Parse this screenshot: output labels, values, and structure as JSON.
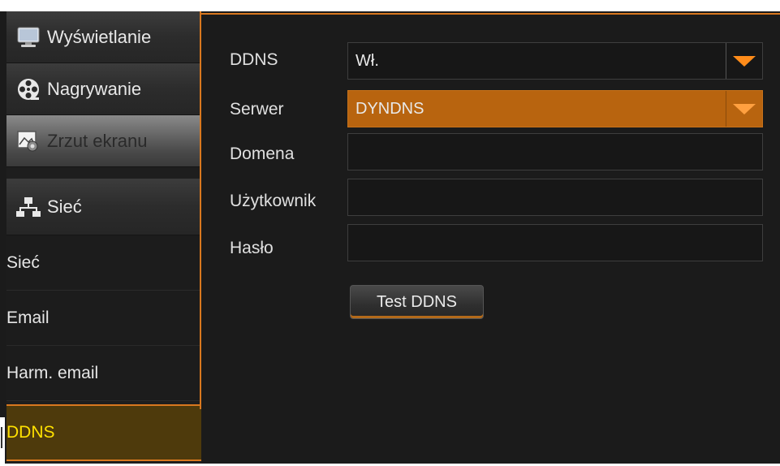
{
  "sidebar": {
    "categories": [
      {
        "label": "Wyświetlanie",
        "icon": "monitor-icon"
      },
      {
        "label": "Nagrywanie",
        "icon": "film-reel-icon"
      },
      {
        "label": "Zrzut ekranu",
        "icon": "snapshot-icon"
      },
      {
        "label": "Sieć",
        "icon": "network-icon"
      }
    ],
    "subitems": [
      {
        "label": "Sieć"
      },
      {
        "label": "Email"
      },
      {
        "label": "Harm. email"
      },
      {
        "label": "DDNS"
      }
    ]
  },
  "form": {
    "ddns": {
      "label": "DDNS",
      "value": "Wł."
    },
    "server": {
      "label": "Serwer",
      "value": "DYNDNS"
    },
    "domain": {
      "label": "Domena",
      "value": ""
    },
    "user": {
      "label": "Użytkownik",
      "value": ""
    },
    "password": {
      "label": "Hasło",
      "value": ""
    },
    "test_button": "Test DDNS"
  },
  "colors": {
    "accent": "#d9781f",
    "active_text": "#ffe100",
    "dropdown_arrow": "#ff8c1a"
  }
}
